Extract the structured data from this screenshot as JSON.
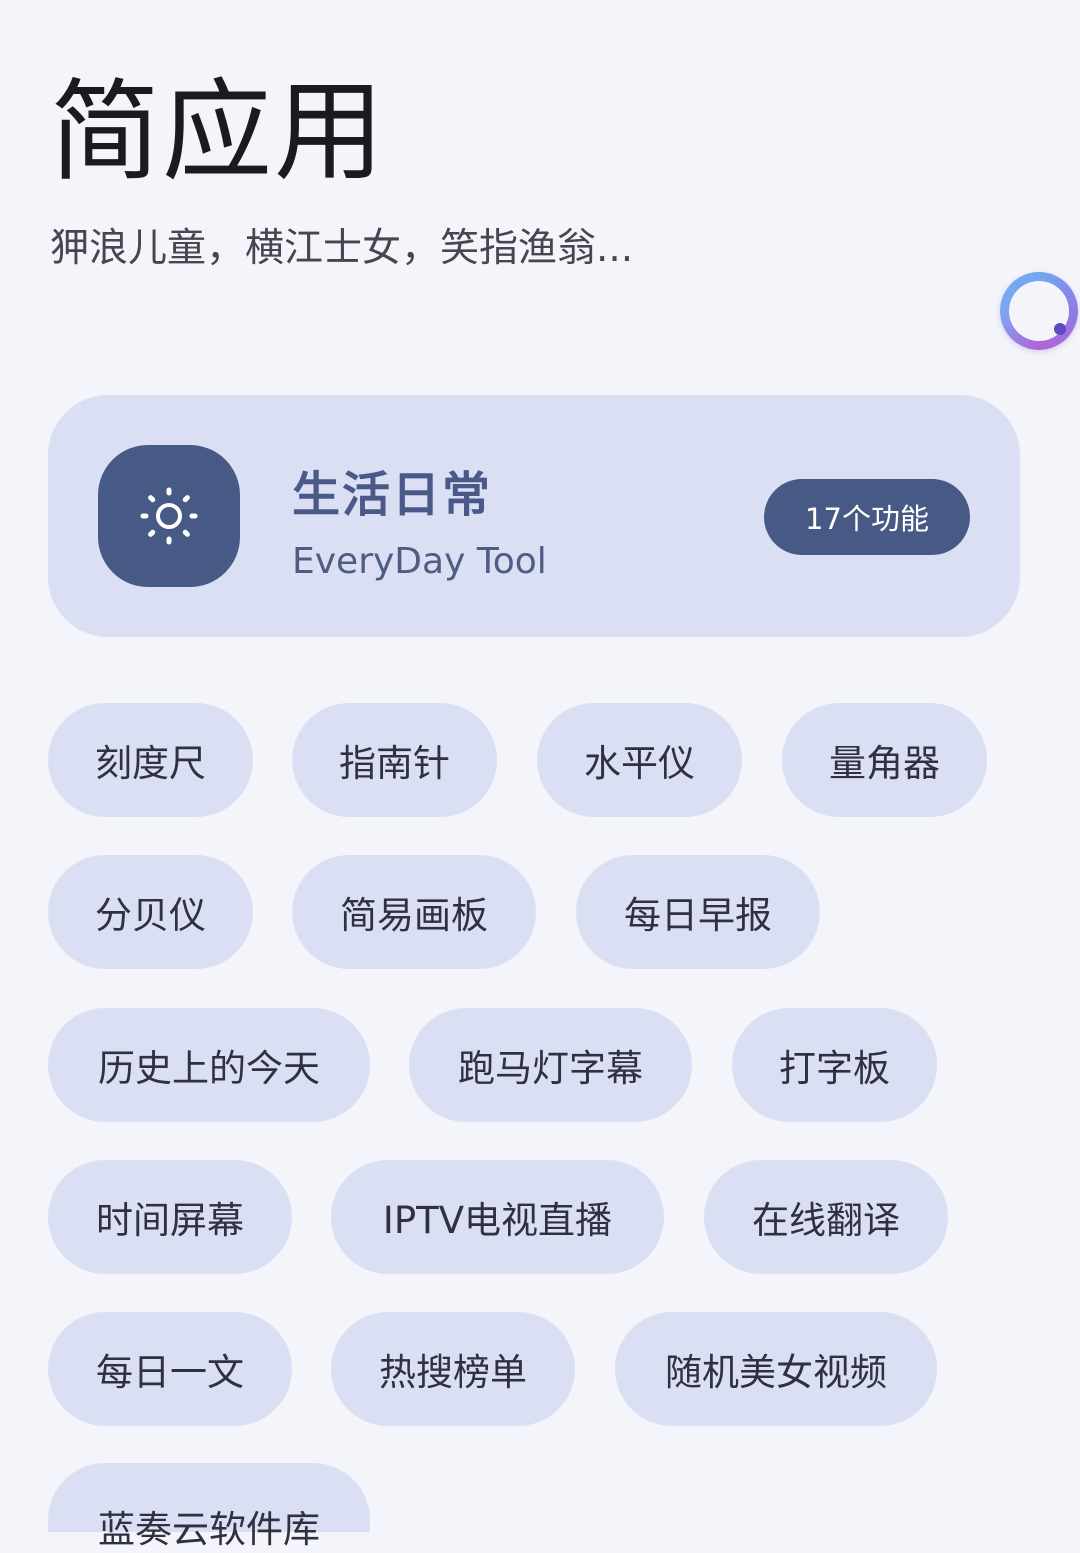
{
  "header": {
    "title": "简应用",
    "subtitle": "狎浪儿童，横江士女，笑指渔翁..."
  },
  "category": {
    "icon": "sun-icon",
    "title": "生活日常",
    "subtitle": "EveryDay Tool",
    "count_label": "17个功能"
  },
  "floating_ball": {
    "icon": "assistant-ball-icon"
  },
  "features": [
    "刻度尺",
    "指南针",
    "水平仪",
    "量角器",
    "分贝仪",
    "简易画板",
    "每日早报",
    "历史上的今天",
    "跑马灯字幕",
    "打字板",
    "时间屏幕",
    "IPTV电视直播",
    "在线翻译",
    "每日一文",
    "热搜榜单",
    "随机美女视频",
    "蓝奏云软件库"
  ],
  "colors": {
    "background": "#f4f4fb",
    "card": "#dadff3",
    "accent": "#475a85",
    "accent_text": "#4a5988"
  }
}
